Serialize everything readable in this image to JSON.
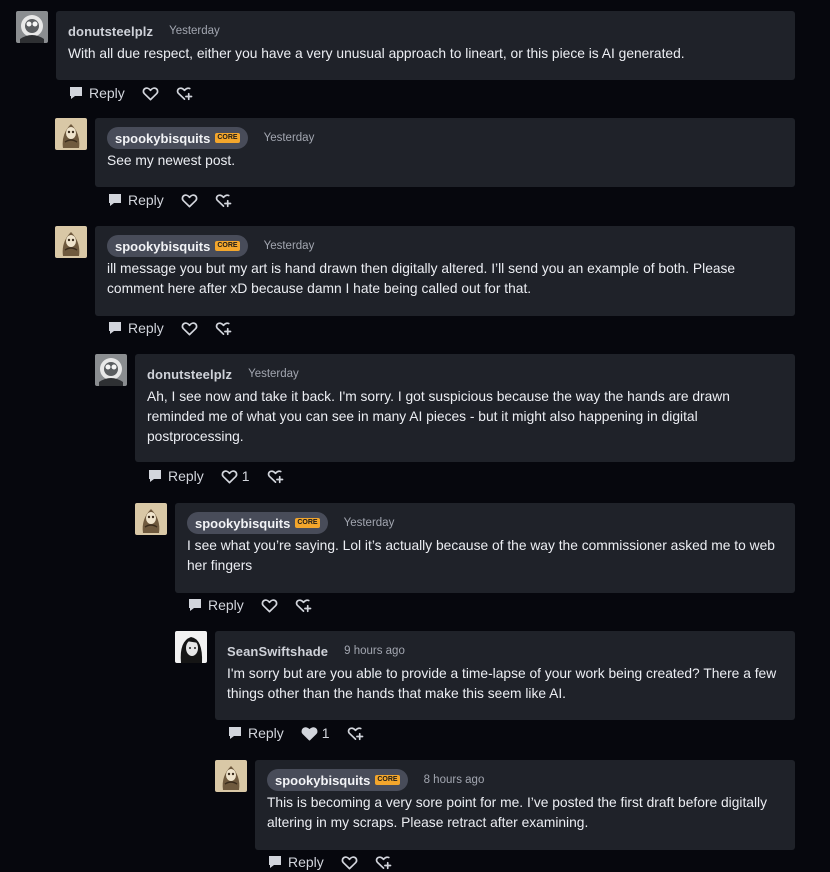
{
  "actions": {
    "reply_label": "Reply"
  },
  "colors": {
    "background": "#06070d",
    "bubble": "#1f2229",
    "core_badge": "#f3a62c",
    "pill": "#484c59"
  },
  "comments": [
    {
      "username": "donutsteelplz",
      "time": "Yesterday",
      "core": false,
      "badge": "",
      "likes": "",
      "text": "With all due respect, either you have a very unusual approach to lineart, or this piece is AI generated."
    },
    {
      "username": "spookybisquits",
      "time": "Yesterday",
      "core": true,
      "badge": "CORE",
      "likes": "",
      "text": "See my newest post."
    },
    {
      "username": "spookybisquits",
      "time": "Yesterday",
      "core": true,
      "badge": "CORE",
      "likes": "",
      "text": "ill message you but my art is hand drawn then digitally altered. I’ll send you an example of both. Please comment here after xD because damn I hate being called out for that."
    },
    {
      "username": "donutsteelplz",
      "time": "Yesterday",
      "core": false,
      "badge": "",
      "likes": "1",
      "text": "Ah, I see now and take it back. I'm sorry. I got suspicious because the way the hands are drawn reminded me of what you can see in many AI pieces - but it might also happening in digital postprocessing."
    },
    {
      "username": "spookybisquits",
      "time": "Yesterday",
      "core": true,
      "badge": "CORE",
      "likes": "",
      "text": "I see what you’re saying. Lol it’s actually because of the way the commissioner asked me to web her fingers"
    },
    {
      "username": "SeanSwiftshade",
      "time": "9 hours ago",
      "core": false,
      "badge": "",
      "likes": "1",
      "text": "I'm sorry but are you able to provide a time-lapse of your work being created? There a few things other than the hands that make this seem like AI."
    },
    {
      "username": "spookybisquits",
      "time": "8 hours ago",
      "core": true,
      "badge": "CORE",
      "likes": "",
      "text": "This is becoming a very sore point for me. I’ve posted the first draft before digitally altering in my scraps. Please retract after examining."
    }
  ]
}
